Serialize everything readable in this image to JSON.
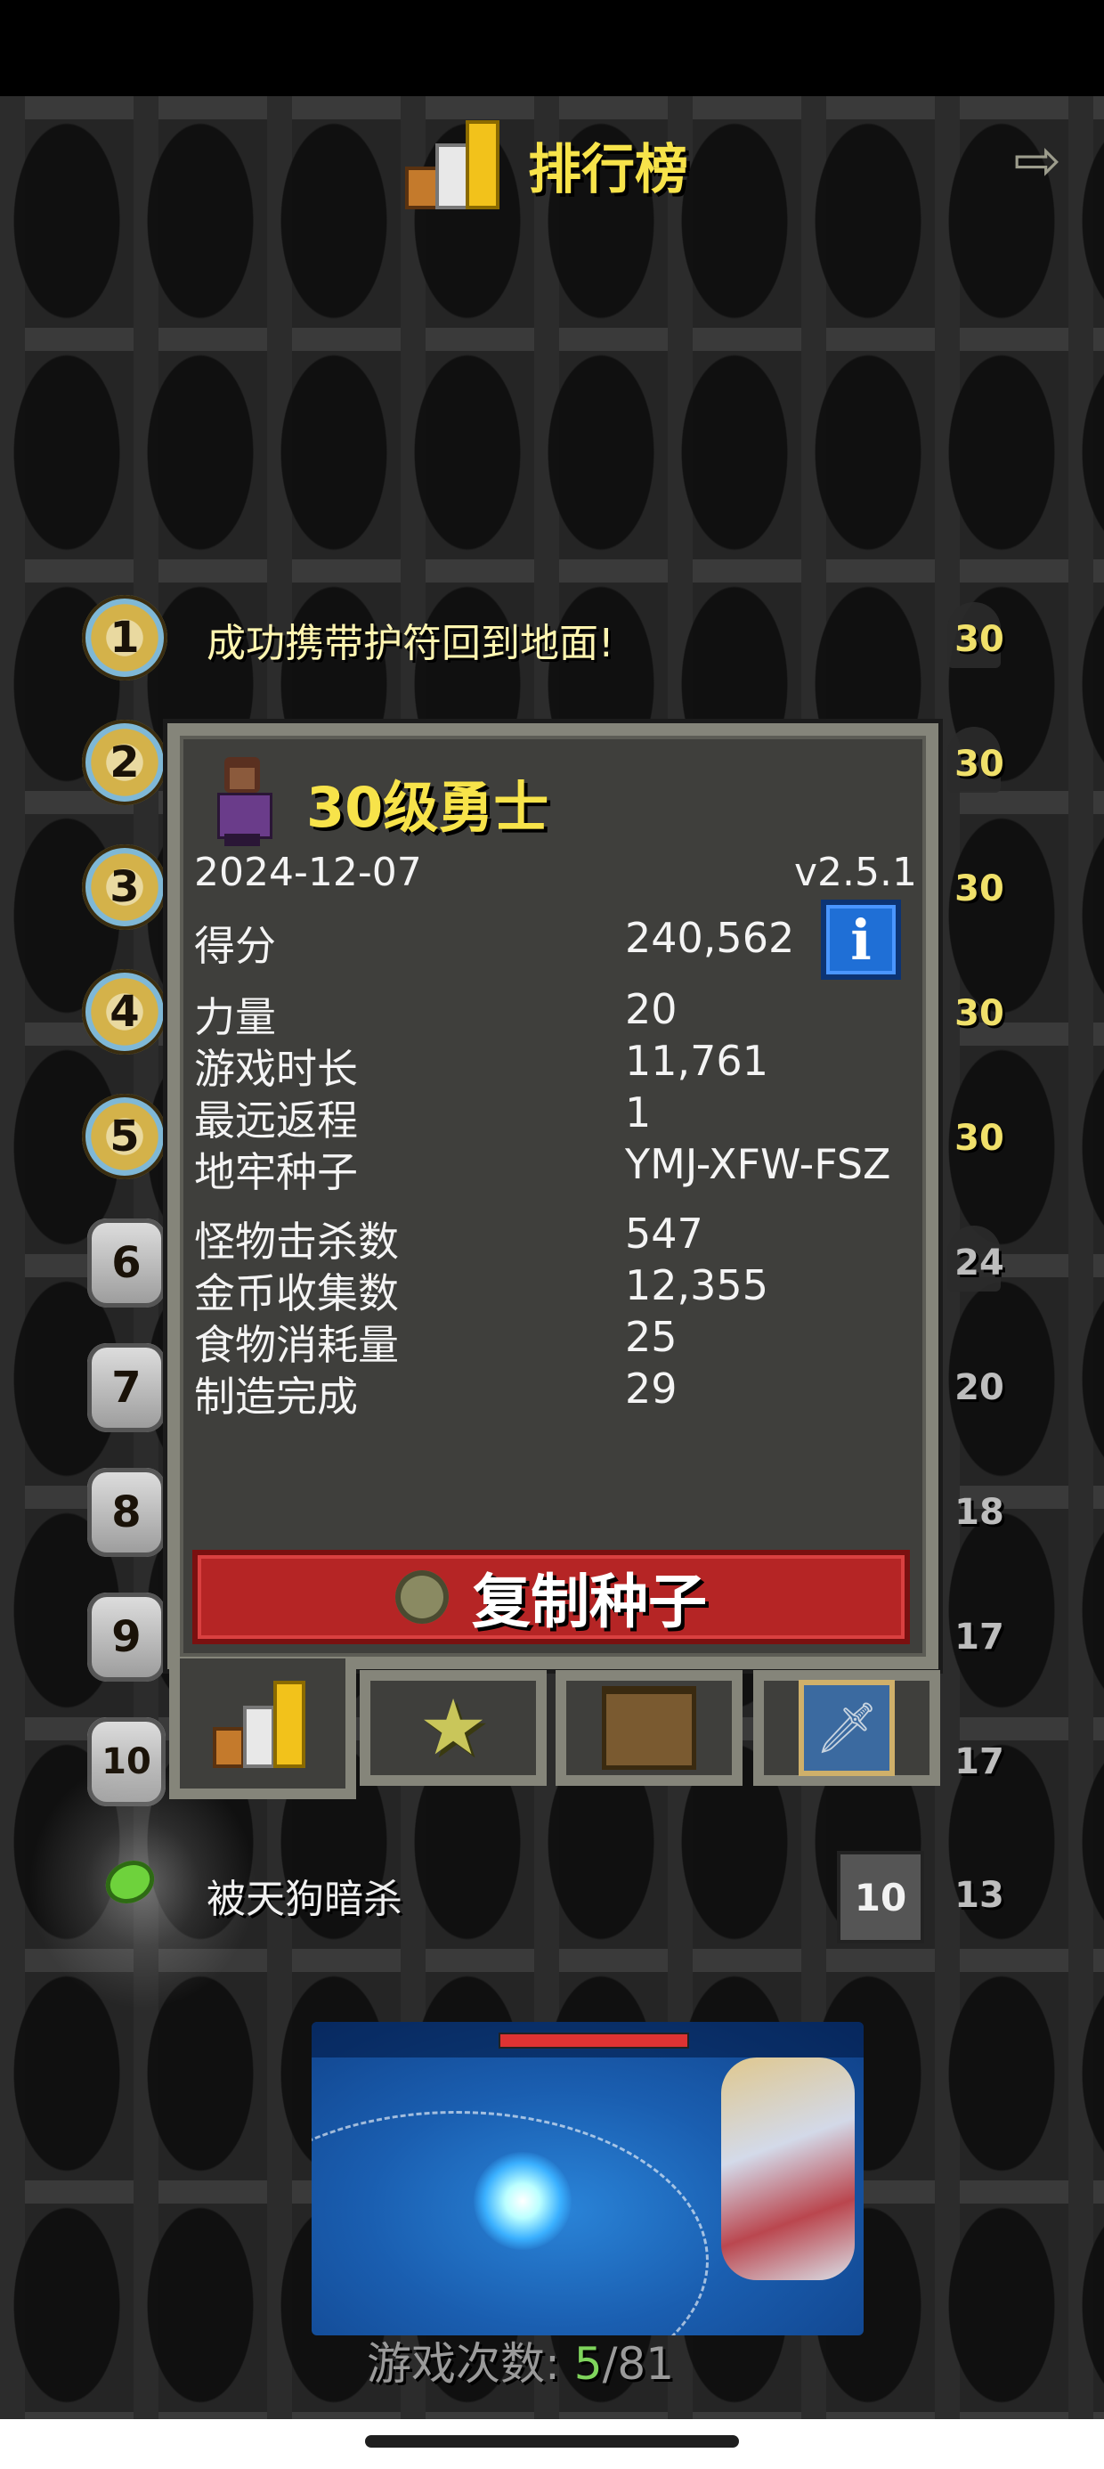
{
  "header": {
    "title": "排行榜",
    "exit_icon": "⇨"
  },
  "rows": [
    {
      "rank": "1",
      "text": "成功携带护符回到地面!",
      "level": "30"
    },
    {
      "rank": "2",
      "text": "",
      "level": "30"
    },
    {
      "rank": "3",
      "text": "",
      "level": "30"
    },
    {
      "rank": "4",
      "text": "",
      "level": "30"
    },
    {
      "rank": "5",
      "text": "",
      "level": "30"
    },
    {
      "rank": "6",
      "text": "",
      "level": "24"
    },
    {
      "rank": "7",
      "text": "",
      "level": "20"
    },
    {
      "rank": "8",
      "text": "",
      "level": "18"
    },
    {
      "rank": "9",
      "text": "",
      "level": "17"
    },
    {
      "rank": "10",
      "text": "",
      "level": "17"
    },
    {
      "rank": "",
      "text": "被天狗暗杀",
      "depth": "10",
      "level": "13"
    }
  ],
  "dialog": {
    "title": "30级勇士",
    "date": "2024-12-07",
    "version": "v2.5.1",
    "stats": [
      {
        "label": "得分",
        "value": "240,562"
      },
      {
        "label": "力量",
        "value": "20"
      },
      {
        "label": "游戏时长",
        "value": "11,761"
      },
      {
        "label": "最远返程",
        "value": "1"
      },
      {
        "label": "地牢种子",
        "value": "YMJ-XFW-FSZ"
      },
      {
        "label": "怪物击杀数",
        "value": "547"
      },
      {
        "label": "金币收集数",
        "value": "12,355"
      },
      {
        "label": "食物消耗量",
        "value": "25"
      },
      {
        "label": "制造完成",
        "value": "29"
      }
    ],
    "info_icon": "i",
    "copy_seed_label": "复制种子"
  },
  "tabs": [
    {
      "name": "rankings",
      "active": true
    },
    {
      "name": "badges",
      "icon": "★"
    },
    {
      "name": "items"
    },
    {
      "name": "journal",
      "icon": "🗡"
    }
  ],
  "ad": {
    "hud_text": ""
  },
  "footer": {
    "games_label": "游戏次数: ",
    "games_won": "5",
    "games_total": "/81"
  }
}
